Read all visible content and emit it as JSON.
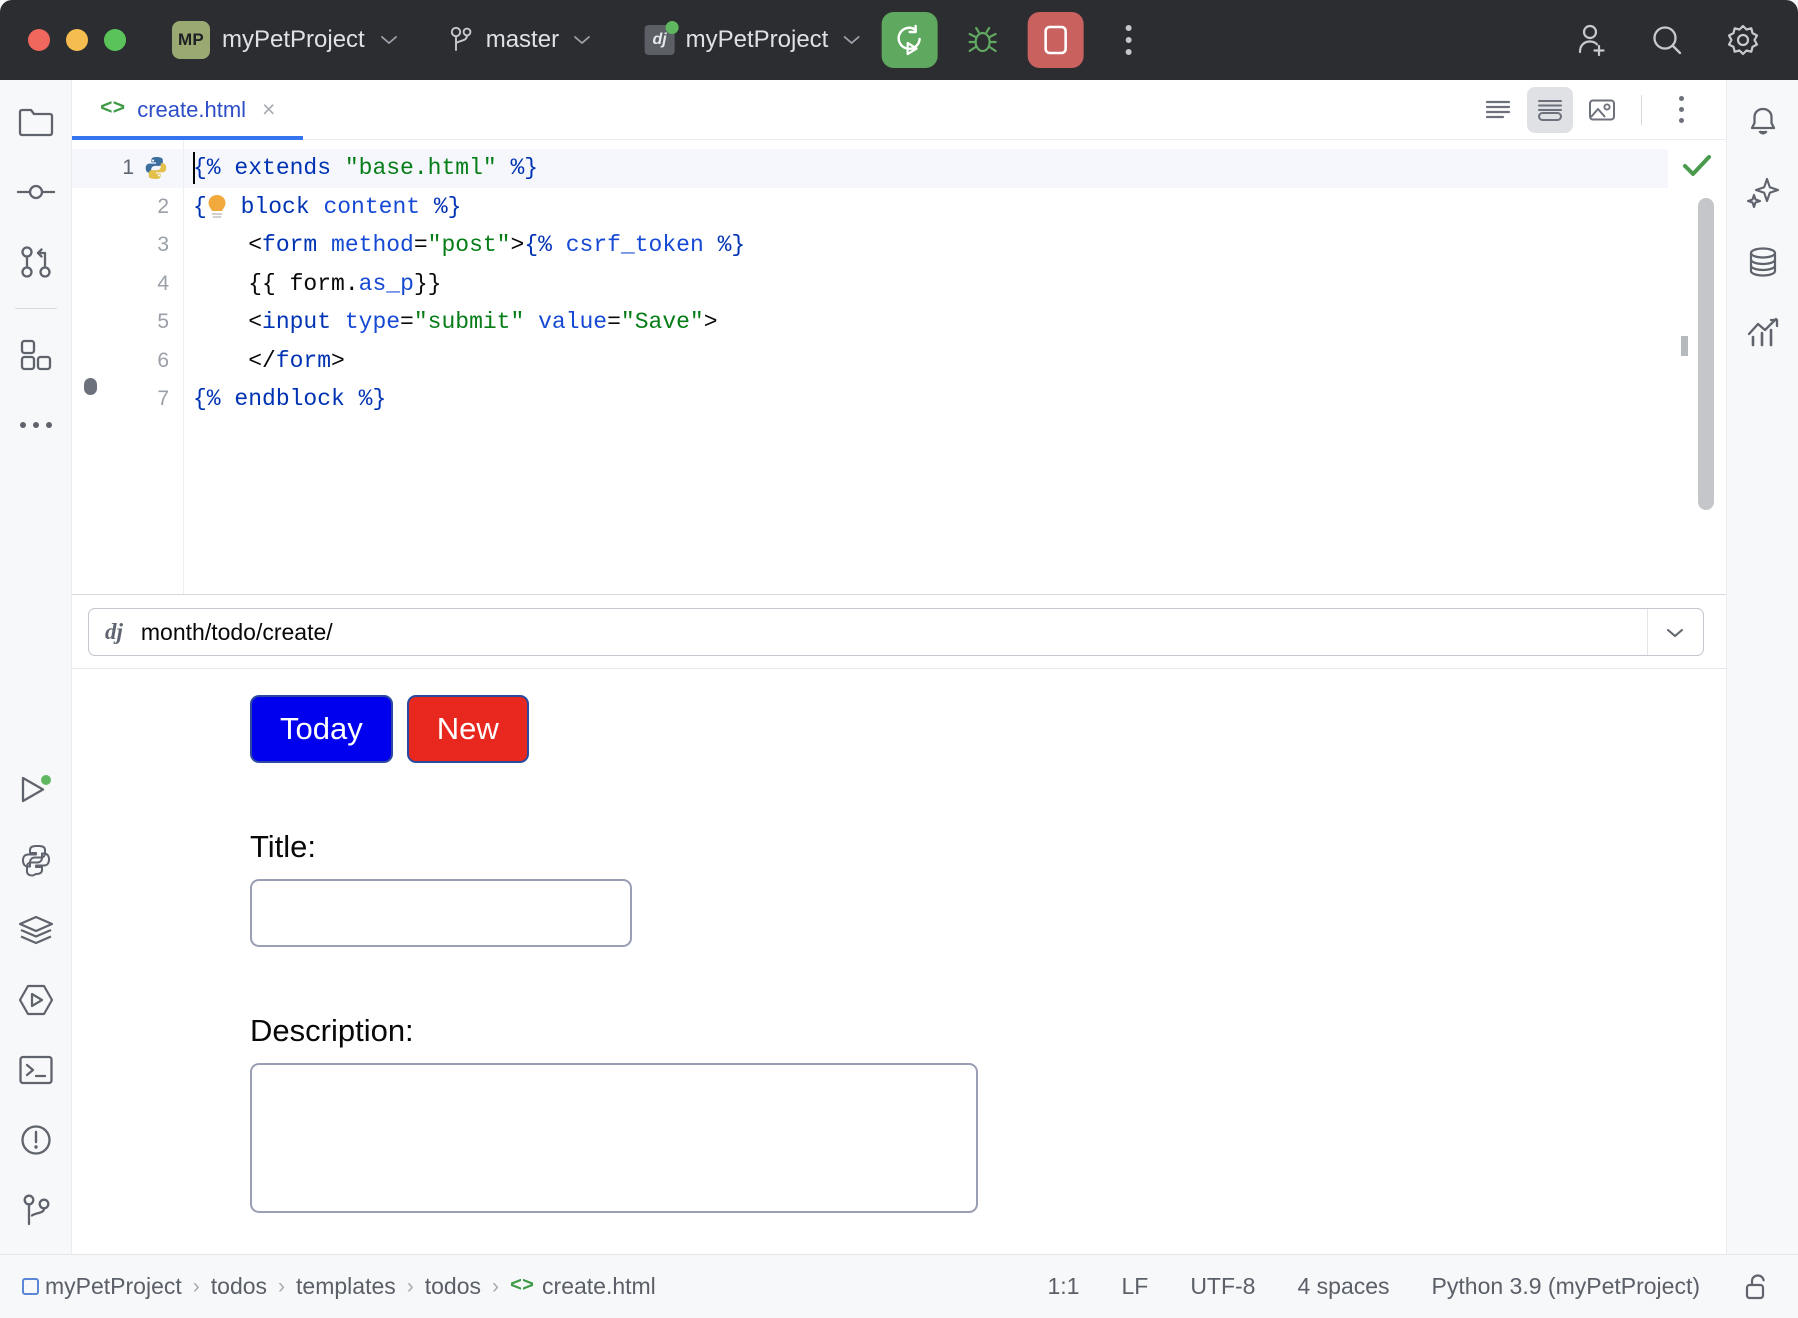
{
  "titlebar": {
    "project_badge": "MP",
    "project_name": "myPetProject",
    "branch": "master",
    "run_config": "myPetProject",
    "icons": {
      "branch": "git-branch-icon",
      "dj": "django-icon",
      "run": "run-rerun-icon",
      "debug": "debug-bug-icon",
      "stop": "stop-icon",
      "more": "more-vertical-icon",
      "invite": "add-user-icon",
      "search": "search-icon",
      "settings": "gear-icon"
    }
  },
  "left_stripe": {
    "items": [
      {
        "name": "project-tool-window",
        "icon": "folder-icon"
      },
      {
        "name": "commit-tool-window",
        "icon": "commit-icon"
      },
      {
        "name": "pull-requests-tool-window",
        "icon": "pull-request-icon"
      },
      {
        "name": "plugins-tool-window",
        "icon": "plugins-icon"
      },
      {
        "name": "more-tool-windows",
        "icon": "more-horizontal-icon"
      }
    ],
    "bottom_items": [
      {
        "name": "run-tool-window",
        "icon": "run-triangle-icon"
      },
      {
        "name": "python-console-tool-window",
        "icon": "python-icon"
      },
      {
        "name": "services-tool-window",
        "icon": "layers-icon"
      },
      {
        "name": "run-anything-tool-window",
        "icon": "hexagon-play-icon"
      },
      {
        "name": "terminal-tool-window",
        "icon": "terminal-icon"
      },
      {
        "name": "problems-tool-window",
        "icon": "warning-circle-icon"
      },
      {
        "name": "version-control-tool-window",
        "icon": "vcs-branch-icon"
      }
    ]
  },
  "right_stripe": {
    "items": [
      {
        "name": "notifications-tool-window",
        "icon": "bell-icon"
      },
      {
        "name": "ai-assistant-tool-window",
        "icon": "sparkle-icon"
      },
      {
        "name": "database-tool-window",
        "icon": "database-icon"
      },
      {
        "name": "profiler-tool-window",
        "icon": "chart-icon"
      }
    ]
  },
  "editor": {
    "tab": {
      "icon": "html-tag-icon",
      "label": "create.html",
      "close": "×"
    },
    "view_controls": [
      {
        "name": "editor-only-view",
        "icon": "lines-icon",
        "selected": false
      },
      {
        "name": "editor-and-preview-view",
        "icon": "split-view-icon",
        "selected": true
      },
      {
        "name": "preview-only-view",
        "icon": "image-icon",
        "selected": false
      },
      {
        "name": "editor-options-menu",
        "icon": "more-vertical-icon",
        "selected": false
      }
    ],
    "inspection_status": "ok",
    "line_numbers": [
      "1",
      "2",
      "3",
      "4",
      "5",
      "6",
      "7"
    ],
    "gutter_icons": {
      "line1": "python-icon",
      "line7": "breakpoint-dot-icon"
    },
    "code_lines": [
      [
        {
          "t": "{% ",
          "c": "k-tag"
        },
        {
          "t": "extends ",
          "c": "k-tag"
        },
        {
          "t": "\"base.html\"",
          "c": "k-str"
        },
        {
          "t": " %}",
          "c": "k-tag"
        }
      ],
      [
        {
          "t": "{%",
          "c": "k-tag"
        },
        {
          "t": " block ",
          "c": "k-tag"
        },
        {
          "t": "content",
          "c": "k-attr"
        },
        {
          "t": " %}",
          "c": "k-tag"
        }
      ],
      [
        {
          "t": "    <",
          "c": "k-punc"
        },
        {
          "t": "form",
          "c": "k-tag"
        },
        {
          "t": " method",
          "c": "k-attr"
        },
        {
          "t": "=",
          "c": "k-punc"
        },
        {
          "t": "\"post\"",
          "c": "k-str"
        },
        {
          "t": ">",
          "c": "k-punc"
        },
        {
          "t": "{% ",
          "c": "k-tag"
        },
        {
          "t": "csrf_token",
          "c": "k-attr"
        },
        {
          "t": " %}",
          "c": "k-tag"
        }
      ],
      [
        {
          "t": "    {{ ",
          "c": "k-punc"
        },
        {
          "t": "form",
          "c": "k-plain"
        },
        {
          "t": ".",
          "c": "k-punc"
        },
        {
          "t": "as_p",
          "c": "k-attr"
        },
        {
          "t": "}}",
          "c": "k-punc"
        }
      ],
      [
        {
          "t": "    <",
          "c": "k-punc"
        },
        {
          "t": "input",
          "c": "k-tag"
        },
        {
          "t": " type",
          "c": "k-attr"
        },
        {
          "t": "=",
          "c": "k-punc"
        },
        {
          "t": "\"submit\"",
          "c": "k-str"
        },
        {
          "t": " value",
          "c": "k-attr"
        },
        {
          "t": "=",
          "c": "k-punc"
        },
        {
          "t": "\"Save\"",
          "c": "k-str"
        },
        {
          "t": ">",
          "c": "k-punc"
        }
      ],
      [
        {
          "t": "    </",
          "c": "k-punc"
        },
        {
          "t": "form",
          "c": "k-tag"
        },
        {
          "t": ">",
          "c": "k-punc"
        }
      ],
      [
        {
          "t": "{% ",
          "c": "k-tag"
        },
        {
          "t": "endblock",
          "c": "k-tag"
        },
        {
          "t": " %}",
          "c": "k-tag"
        }
      ]
    ]
  },
  "preview": {
    "url_icon": "dj",
    "url": "month/todo/create/",
    "url_dropdown_icon": "chevron-down-icon",
    "buttons": [
      {
        "label": "Today",
        "color": "#0000ee"
      },
      {
        "label": "New",
        "color": "#e8271e"
      }
    ],
    "fields": [
      {
        "label": "Title:",
        "value": "",
        "type": "text"
      },
      {
        "label": "Description:",
        "value": "",
        "type": "textarea"
      }
    ]
  },
  "statusbar": {
    "breadcrumbs": [
      "myPetProject",
      "todos",
      "templates",
      "todos",
      "create.html"
    ],
    "separator": "›",
    "caret_position": "1:1",
    "line_separator": "LF",
    "encoding": "UTF-8",
    "indent": "4 spaces",
    "interpreter": "Python 3.9 (myPetProject)",
    "lock_icon": "unlocked-icon"
  },
  "colors": {
    "titlebar_bg": "#2b2d30",
    "accent_blue": "#3574f0",
    "run_green": "#5fa85f",
    "stop_red": "#c9625f",
    "tab_label": "#2e4ec7",
    "string_green": "#067d17",
    "keyword_blue": "#0033b3"
  }
}
